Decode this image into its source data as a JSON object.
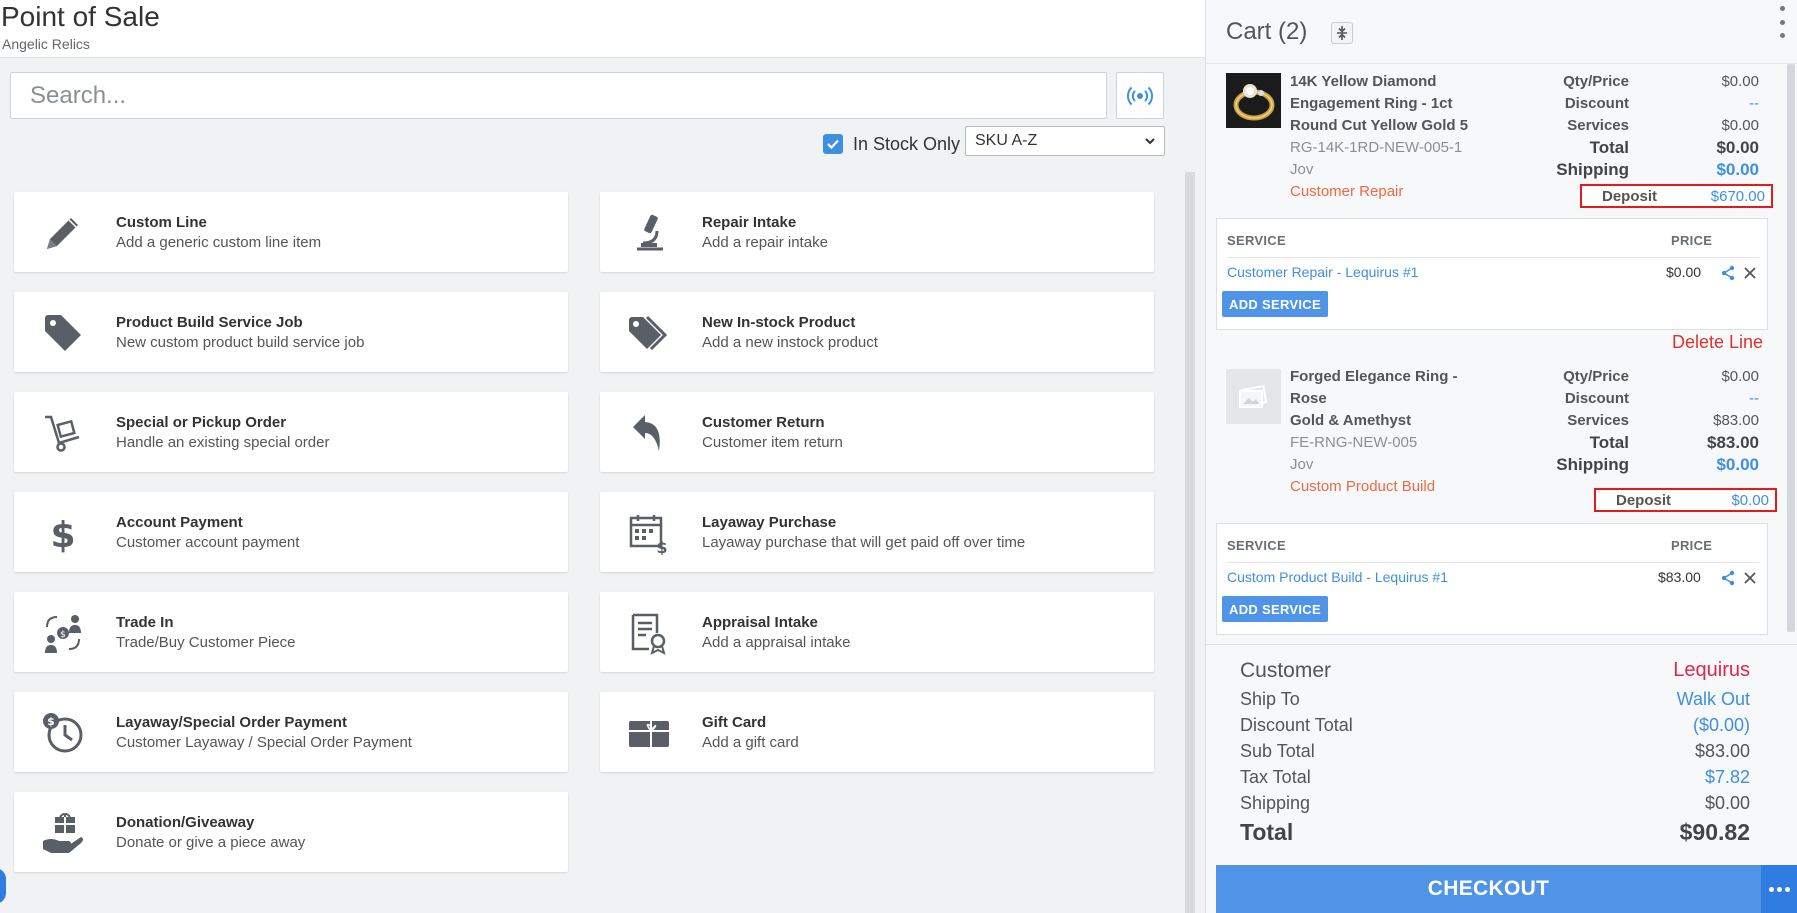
{
  "header": {
    "title": "Point of Sale",
    "subtitle": "Angelic Relics"
  },
  "search": {
    "placeholder": "Search..."
  },
  "filters": {
    "in_stock_label": "In Stock Only",
    "in_stock_checked": true,
    "sort_value": "SKU A-Z"
  },
  "tiles": [
    {
      "icon": "pencil-icon",
      "title": "Custom Line",
      "subtitle": "Add a generic custom line item"
    },
    {
      "icon": "microscope-icon",
      "title": "Repair Intake",
      "subtitle": "Add a repair intake"
    },
    {
      "icon": "tag-icon",
      "title": "Product Build Service Job",
      "subtitle": "New custom product build service job"
    },
    {
      "icon": "tags-icon",
      "title": "New In-stock Product",
      "subtitle": "Add a new instock product"
    },
    {
      "icon": "dolly-icon",
      "title": "Special or Pickup Order",
      "subtitle": "Handle an existing special order"
    },
    {
      "icon": "return-arrow-icon",
      "title": "Customer Return",
      "subtitle": "Customer item return"
    },
    {
      "icon": "dollar-icon",
      "title": "Account Payment",
      "subtitle": "Customer account payment"
    },
    {
      "icon": "calendar-dollar-icon",
      "title": "Layaway Purchase",
      "subtitle": "Layaway purchase that will get paid off over time"
    },
    {
      "icon": "trade-in-icon",
      "title": "Trade In",
      "subtitle": "Trade/Buy Customer Piece"
    },
    {
      "icon": "certificate-icon",
      "title": "Appraisal Intake",
      "subtitle": "Add a appraisal intake"
    },
    {
      "icon": "clock-dollar-icon",
      "title": "Layaway/Special Order Payment",
      "subtitle": "Customer Layaway / Special Order Payment"
    },
    {
      "icon": "gift-card-icon",
      "title": "Gift Card",
      "subtitle": "Add a gift card"
    },
    {
      "icon": "gift-hand-icon",
      "title": "Donation/Giveaway",
      "subtitle": "Donate or give a piece away"
    }
  ],
  "cart": {
    "title": "Cart (2)",
    "labels": {
      "qty_price": "Qty/Price",
      "discount": "Discount",
      "services": "Services",
      "total": "Total",
      "shipping": "Shipping",
      "deposit": "Deposit",
      "service_header": "SERVICE",
      "price_header": "PRICE",
      "add_service": "ADD SERVICE"
    },
    "items": [
      {
        "name_line1": "14K Yellow Diamond",
        "name_line2": "Engagement Ring - 1ct",
        "name_line3": "Round Cut Yellow Gold 5",
        "sku": "RG-14K-1RD-NEW-005-1",
        "staff": "Jov",
        "type": "Customer Repair",
        "qty_price": "$0.00",
        "discount": "--",
        "services": "$0.00",
        "total": "$0.00",
        "shipping": "$0.00",
        "deposit": "$670.00",
        "service_name": "Customer Repair - Lequirus #1",
        "service_price": "$0.00"
      },
      {
        "name_line1": "Forged Elegance Ring - Rose",
        "name_line2": "Gold & Amethyst",
        "sku": "FE-RNG-NEW-005",
        "staff": "Jov",
        "type": "Custom Product Build",
        "qty_price": "$0.00",
        "discount": "--",
        "services": "$83.00",
        "total": "$83.00",
        "shipping": "$0.00",
        "deposit": "$0.00",
        "service_name": "Custom Product Build - Lequirus #1",
        "service_price": "$83.00"
      }
    ],
    "delete_line": "Delete Line"
  },
  "summary": {
    "customer_label": "Customer",
    "customer_value": "Lequirus",
    "ship_to_label": "Ship To",
    "ship_to_value": "Walk Out",
    "discount_total_label": "Discount Total",
    "discount_total_value": "($0.00)",
    "sub_total_label": "Sub Total",
    "sub_total_value": "$83.00",
    "tax_total_label": "Tax Total",
    "tax_total_value": "$7.82",
    "shipping_label": "Shipping",
    "shipping_value": "$0.00",
    "total_label": "Total",
    "total_value": "$90.82"
  },
  "checkout": {
    "label": "CHECKOUT"
  },
  "colors": {
    "accent": "#4f94e6",
    "deposit_outline": "#e21b1b",
    "type_orange": "#ee6a42",
    "customer_red": "#e0264e",
    "delete_red": "#e03131"
  }
}
